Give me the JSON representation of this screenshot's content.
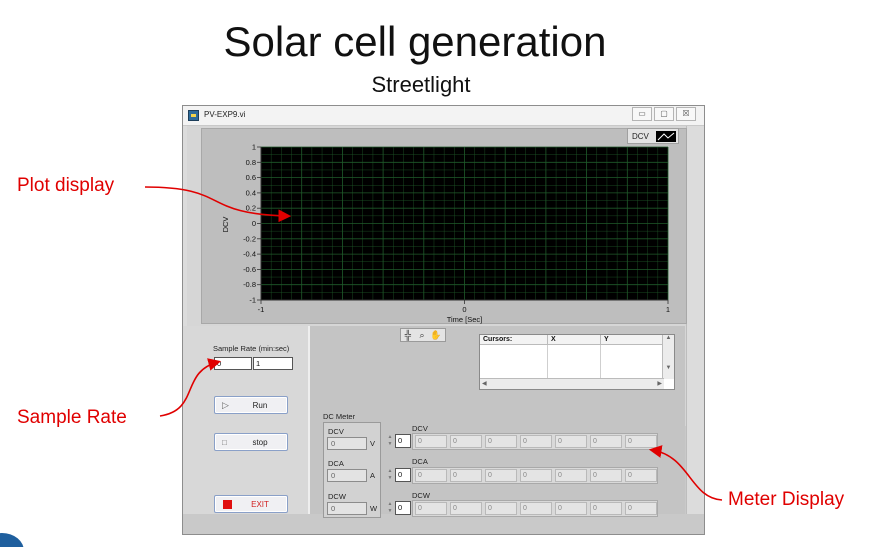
{
  "slide": {
    "title": "Solar cell generation",
    "subtitle": "Streetlight"
  },
  "window": {
    "title": "PV-EXP9.vi",
    "minimize_label": "▭",
    "maximize_label": "▢",
    "close_label": "☒"
  },
  "legend": {
    "label": "DCV"
  },
  "chart_data": {
    "type": "line",
    "title": "",
    "xlabel": "Time [Sec]",
    "ylabel": "DCV",
    "xlim": [
      -1,
      1
    ],
    "ylim": [
      -1,
      1
    ],
    "x_ticks": [
      "-1",
      "0",
      "1"
    ],
    "y_ticks": [
      "1",
      "0.8",
      "0.6",
      "0.4",
      "0.2",
      "0",
      "-0.2",
      "-0.4",
      "-0.6",
      "-0.8",
      "-1"
    ],
    "grid": true,
    "background": "#000000",
    "grid_color": "#1f5a2a",
    "series": []
  },
  "controls": {
    "sample_rate_label": "Sample Rate (min:sec)",
    "sample_rate_min": "0",
    "sample_rate_sec": "1",
    "run_label": "Run",
    "stop_label": "stop",
    "exit_label": "EXIT"
  },
  "cursors": {
    "headers": [
      "Cursors:",
      "X",
      "Y"
    ]
  },
  "dc_meter": {
    "group_label": "DC Meter",
    "channels": [
      {
        "label": "DCV",
        "value": "0",
        "unit": "V",
        "index": "0",
        "array_label": "DCV",
        "array_values": [
          "0",
          "0",
          "0",
          "0",
          "0",
          "0",
          "0"
        ]
      },
      {
        "label": "DCA",
        "value": "0",
        "unit": "A",
        "index": "0",
        "array_label": "DCA",
        "array_values": [
          "0",
          "0",
          "0",
          "0",
          "0",
          "0",
          "0"
        ]
      },
      {
        "label": "DCW",
        "value": "0",
        "unit": "W",
        "index": "0",
        "array_label": "DCW",
        "array_values": [
          "0",
          "0",
          "0",
          "0",
          "0",
          "0",
          "0"
        ]
      }
    ]
  },
  "annotations": {
    "plot_display": "Plot display",
    "sample_rate": "Sample Rate",
    "meter_display": "Meter Display",
    "color": "#e00000"
  }
}
